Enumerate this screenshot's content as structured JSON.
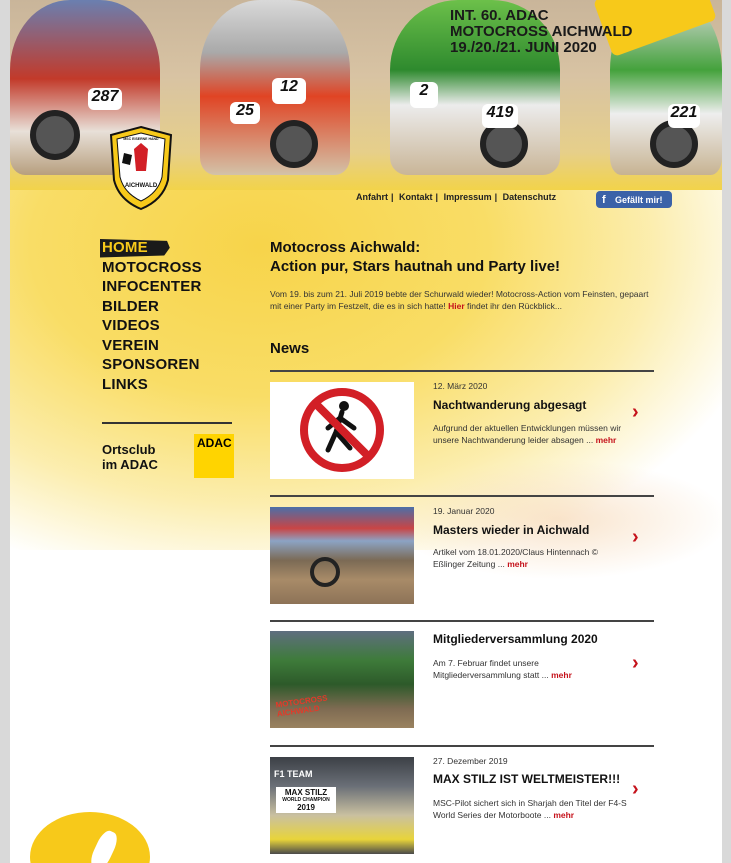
{
  "event": {
    "line1": "INT. 60. ADAC",
    "line2": "MOTOCROSS AICHWALD",
    "line3": "19./20./21. JUNI 2020"
  },
  "plates": [
    "287",
    "25",
    "12",
    "2",
    "419",
    "221"
  ],
  "logo": {
    "top": "MSC EISERNE HAND",
    "bottom": "AICHWALD"
  },
  "toplinks": [
    "Anfahrt",
    "Kontakt",
    "Impressum",
    "Datenschutz"
  ],
  "facebook": {
    "label": "Gefällt mir!"
  },
  "nav": [
    "HOME",
    "MOTOCROSS",
    "INFOCENTER",
    "BILDER",
    "VIDEOS",
    "VEREIN",
    "SPONSOREN",
    "LINKS"
  ],
  "ortsclub": {
    "line1": "Ortsclub",
    "line2": "im ADAC",
    "badge": "ADAC"
  },
  "headline": {
    "line1": "Motocross Aichwald:",
    "line2": "Action pur, Stars hautnah und Party live!"
  },
  "intro": {
    "before": "Vom 19. bis zum 21. Juli 2019 bebte der Schurwald wieder! Motocross-Action vom Feinsten, gepaart mit einer Party im Festzelt, die es in sich hatte! ",
    "link": "Hier",
    "after": " findet ihr den Rückblick..."
  },
  "news_heading": "News",
  "news": [
    {
      "date": "12. März 2020",
      "title": "Nachtwanderung abgesagt",
      "text": "Aufgrund der aktuellen Entwicklungen müssen wir unsere Nachtwanderung leider absagen ...",
      "more": "mehr"
    },
    {
      "date": "19. Januar 2020",
      "title": "Masters wieder in Aichwald",
      "text": "Artikel vom 18.01.2020/Claus Hintennach © Eßlinger Zeitung ...",
      "more": "mehr"
    },
    {
      "date": "",
      "title": "Mitgliederversammlung 2020",
      "text": "Am 7. Februar findet unsere Mitgliederversammlung statt ...",
      "more": "mehr"
    },
    {
      "date": "27. Dezember 2019",
      "title": "MAX STILZ IST WELTMEISTER!!!",
      "text": "MSC-Pilot sichert sich in Sharjah den Titel der F4-S World Series der Motorboote ...",
      "more": "mehr"
    }
  ],
  "thumb3_caption": {
    "line1": "MOTOCROSS",
    "line2": "AICHWALD"
  },
  "thumb4_caption": {
    "team": "F1 TEAM",
    "name": "MAX STILZ",
    "title": "WORLD CHAMPION",
    "year": "2019"
  },
  "colors": {
    "accent": "#f7c91a",
    "link": "#c5121b",
    "fb": "#3b62a8"
  }
}
